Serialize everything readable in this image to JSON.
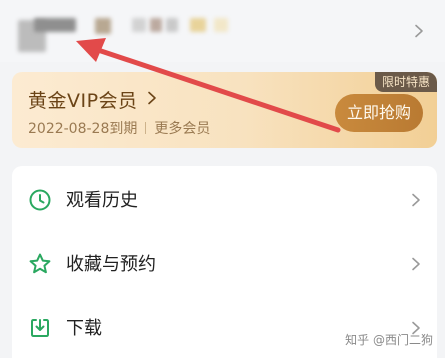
{
  "colors": {
    "accent_green": "#2aa860",
    "vip_brown": "#6b4417",
    "buy_button": "#c08438",
    "annotation_red": "#e24a4a"
  },
  "vip": {
    "title": "黄金VIP会员",
    "expiry": "2022-08-28到期",
    "more": "更多会员",
    "promo_tag": "限时特惠",
    "buy_label": "立即抢购"
  },
  "menu": {
    "items": [
      {
        "label": "观看历史",
        "icon": "clock-icon"
      },
      {
        "label": "收藏与预约",
        "icon": "star-icon"
      },
      {
        "label": "下载",
        "icon": "download-icon"
      }
    ]
  },
  "watermark": "知乎 @西门二狗"
}
